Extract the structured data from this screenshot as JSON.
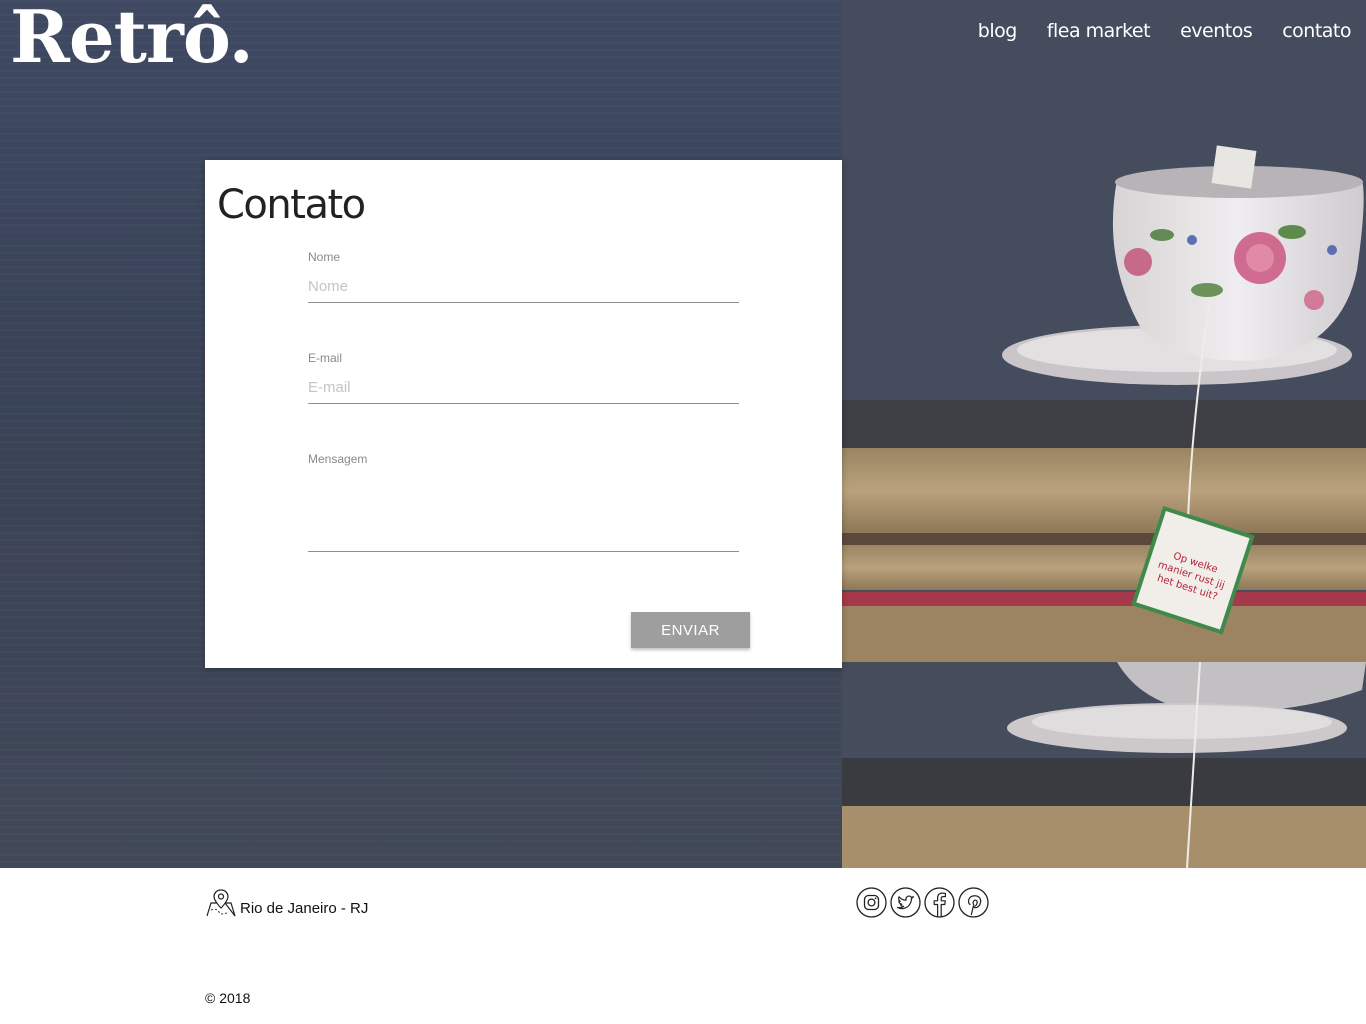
{
  "header": {
    "logo": "Retrô.",
    "nav": [
      "blog",
      "flea market",
      "eventos",
      "contato"
    ]
  },
  "contact": {
    "title": "Contato",
    "name_label": "Nome",
    "name_placeholder": "Nome",
    "email_label": "E-mail",
    "email_placeholder": "E-mail",
    "message_label": "Mensagem",
    "submit_label": "ENVIAR"
  },
  "teabag_tag": [
    "Op welke",
    "manier rust jij",
    "het best uit?"
  ],
  "footer": {
    "location": "Rio de Janeiro - RJ",
    "social": [
      "instagram-icon",
      "twitter-icon",
      "facebook-icon",
      "pinterest-icon"
    ],
    "copyright": "© 2018"
  },
  "colors": {
    "hero_bg": "#3d4659",
    "card_bg": "#ffffff",
    "button_bg": "#9e9e9e",
    "tag_border": "#3f8a4a",
    "tag_text": "#b3233a"
  }
}
